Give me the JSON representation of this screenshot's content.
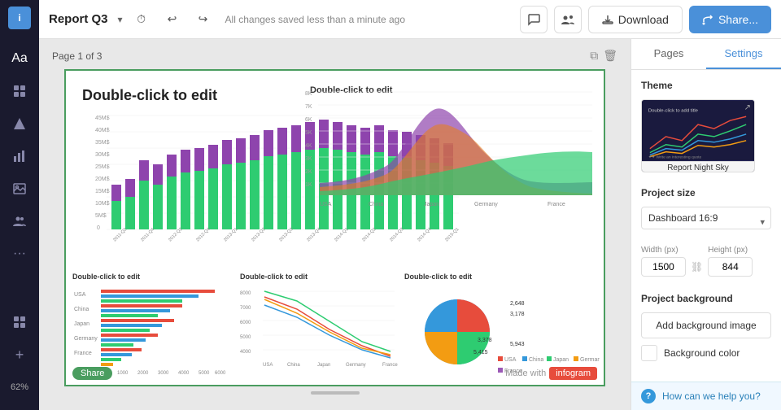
{
  "app": {
    "logo_text": "i",
    "title": "Report Q3",
    "saved_text": "All changes saved less than a minute ago",
    "zoom_level": "62%",
    "page_info": "Page 1 of 3"
  },
  "toolbar": {
    "download_label": "Download",
    "share_label": "Share...",
    "history_icon": "⏱",
    "undo_icon": "↩",
    "redo_icon": "↪"
  },
  "sidebar": {
    "icons": [
      "Aa",
      "≡",
      "⬡",
      "☆",
      "🖼",
      "👥",
      "···"
    ],
    "bottom_icons": [
      "⊞",
      "+"
    ]
  },
  "slide": {
    "main_title": "Double-click to edit",
    "subtitle1": "Double-click to edit",
    "subtitle2": "Double-click to edit",
    "subtitle3": "Double-click to edit",
    "subtitle4": "Double-click to edit",
    "share_badge": "Share",
    "made_with": "Made with",
    "infogram_badge": "infogram"
  },
  "right_panel": {
    "tabs": [
      "Pages",
      "Settings"
    ],
    "active_tab": "Settings",
    "theme_section": "Theme",
    "theme_name": "Report Night Sky",
    "project_size_section": "Project size",
    "project_size_option": "Dashboard 16:9",
    "width_label": "Width (px)",
    "height_label": "Height (px)",
    "width_value": "1500",
    "height_value": "844",
    "project_bg_section": "Project background",
    "add_bg_image_label": "Add background image",
    "bg_color_label": "Background color",
    "help_text": "How can we help you?"
  }
}
